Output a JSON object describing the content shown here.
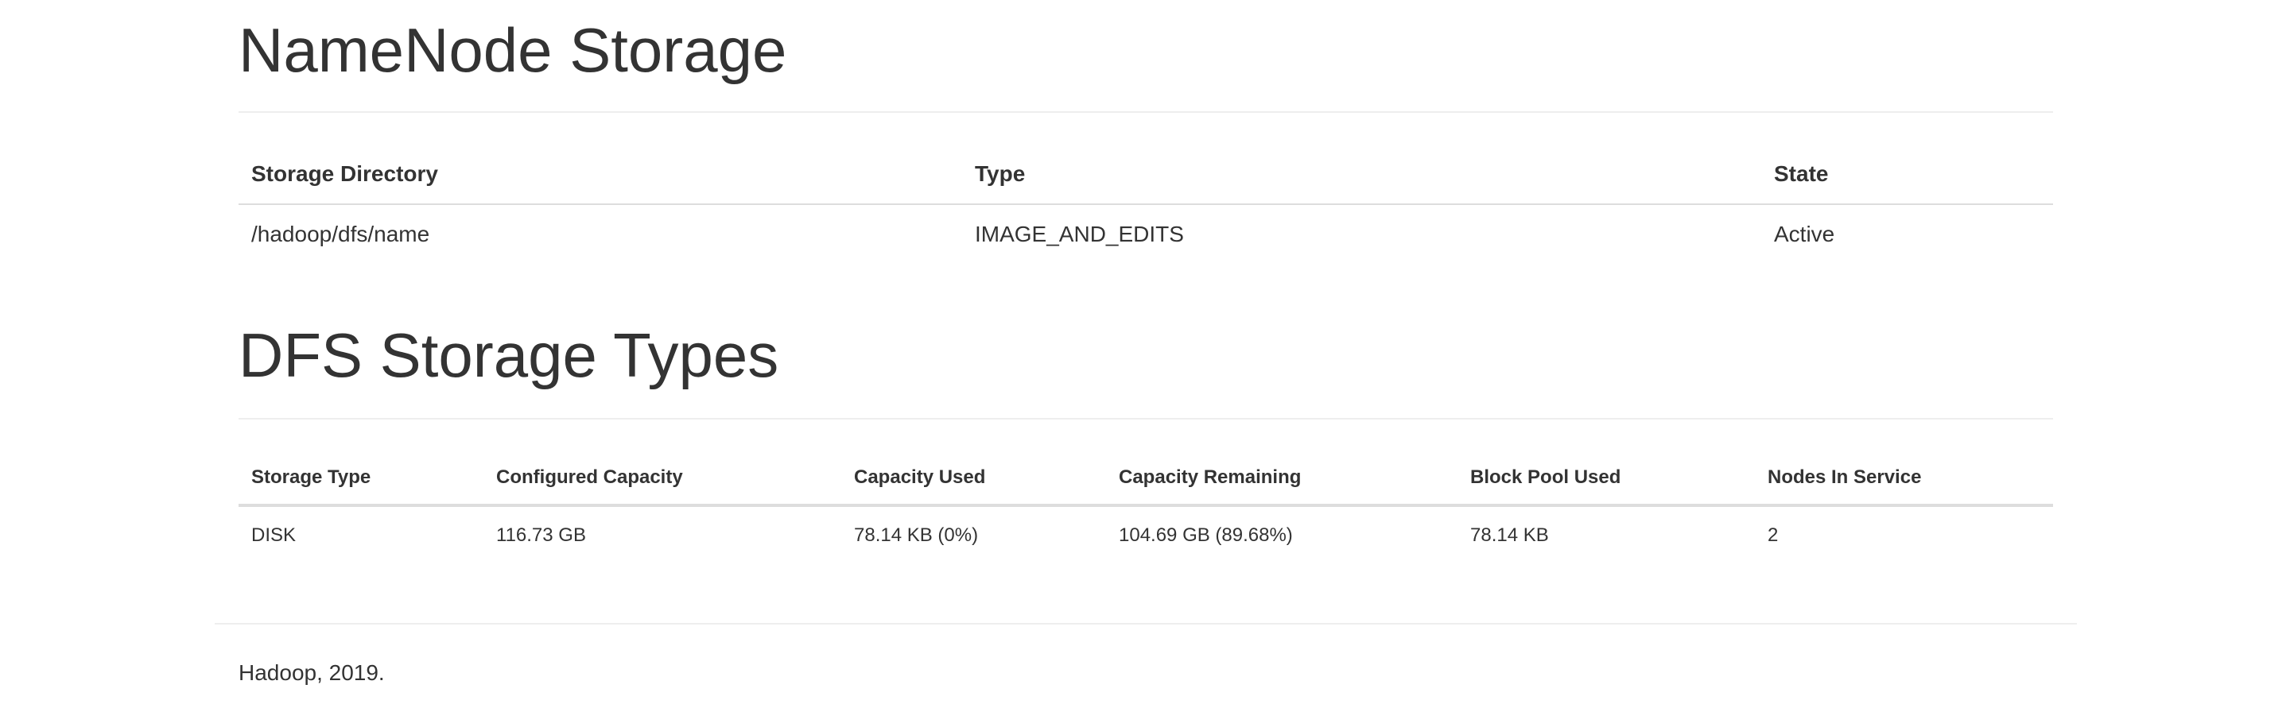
{
  "namenode_storage": {
    "title": "NameNode Storage",
    "columns": [
      "Storage Directory",
      "Type",
      "State"
    ],
    "rows": [
      [
        "/hadoop/dfs/name",
        "IMAGE_AND_EDITS",
        "Active"
      ]
    ]
  },
  "dfs_storage_types": {
    "title": "DFS Storage Types",
    "columns": [
      "Storage Type",
      "Configured Capacity",
      "Capacity Used",
      "Capacity Remaining",
      "Block Pool Used",
      "Nodes In Service"
    ],
    "rows": [
      [
        "DISK",
        "116.73 GB",
        "78.14 KB (0%)",
        "104.69 GB (89.68%)",
        "78.14 KB",
        "2"
      ]
    ]
  },
  "footer": {
    "text": "Hadoop, 2019."
  }
}
